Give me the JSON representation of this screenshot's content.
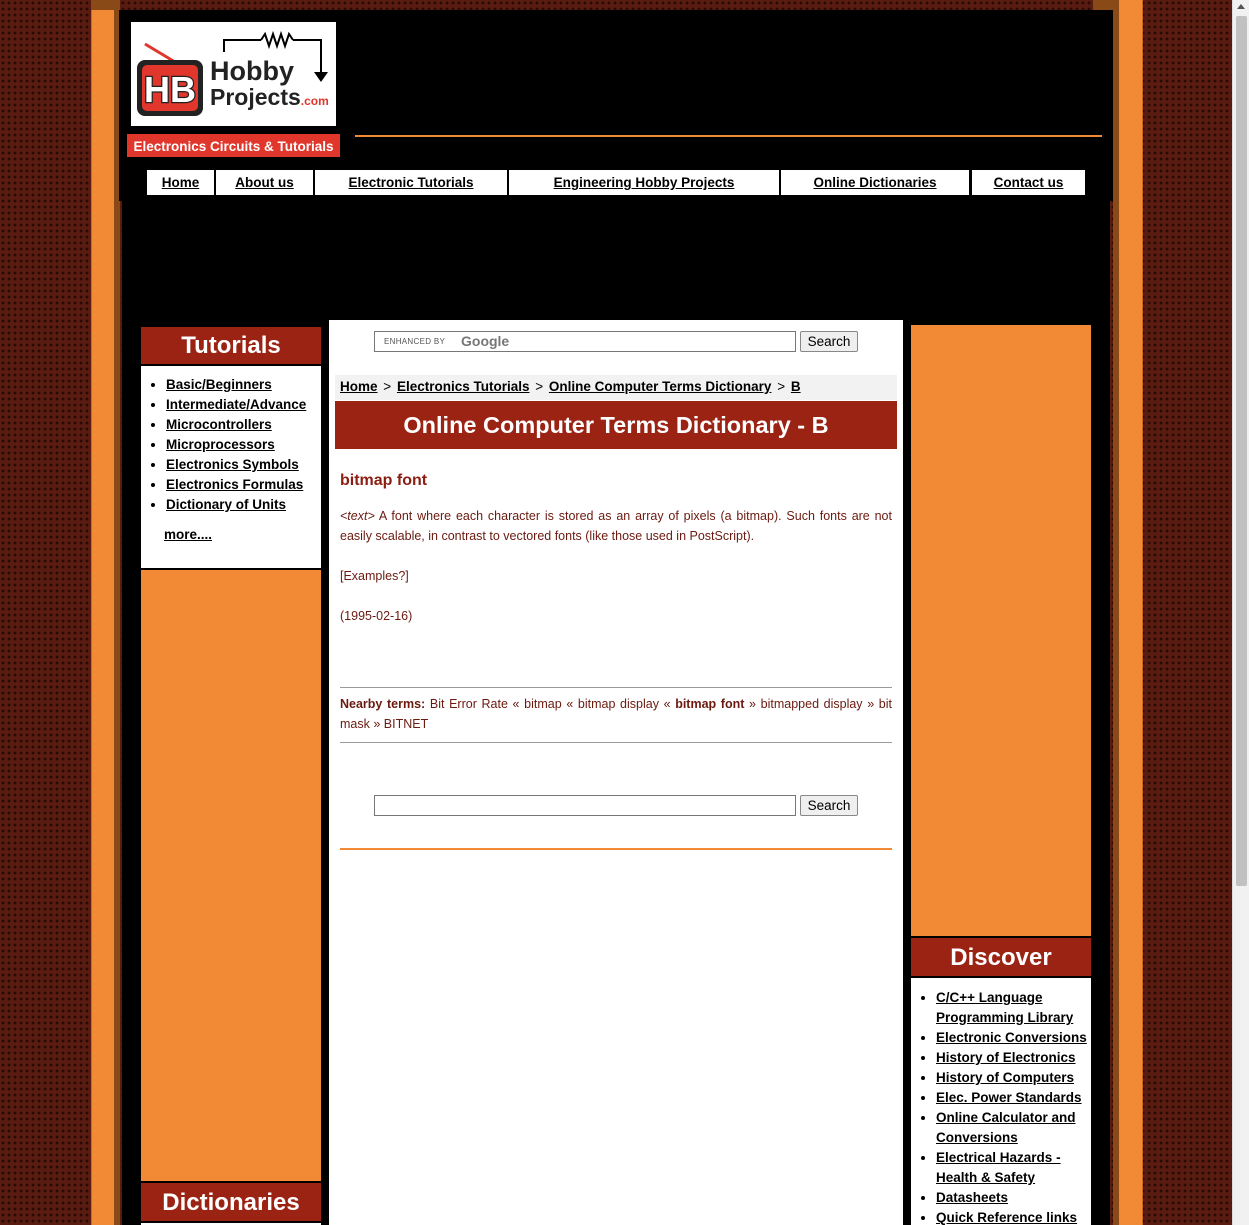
{
  "header": {
    "logo_text_line1": "Hobby",
    "logo_text_line2": "Projects",
    "logo_text_suffix": ".com",
    "logo_monogram": "HB",
    "tagline": "Electronics Circuits & Tutorials"
  },
  "nav": {
    "items": [
      "Home",
      "About us",
      "Electronic Tutorials",
      "Engineering Hobby Projects",
      "Online Dictionaries",
      "Contact us"
    ]
  },
  "left_sidebar": {
    "tutorials_heading": "Tutorials",
    "tutorials_items": [
      "Basic/Beginners",
      "Intermediate/Advance",
      "Microcontrollers",
      "Microprocessors",
      "Electronics Symbols",
      "Electronics Formulas",
      "Dictionary of Units"
    ],
    "more_link": "more....",
    "dictionaries_heading": "Dictionaries"
  },
  "right_sidebar": {
    "discover_heading": "Discover",
    "discover_items": [
      "C/C++ Language Programming Library",
      "Electronic Conversions",
      "History of Electronics",
      "History of Computers",
      "Elec. Power Standards",
      "Online Calculator and Conversions",
      "Electrical Hazards - Health & Safety",
      "Datasheets",
      "Quick Reference links"
    ]
  },
  "search": {
    "brand_prefix": "ENHANCED BY",
    "brand_name": "Google",
    "button_label": "Search",
    "bottom_button_label": "Search"
  },
  "breadcrumb": {
    "items": [
      "Home",
      "Electronics Tutorials",
      "Online Computer Terms Dictionary",
      "B"
    ],
    "separator": ">"
  },
  "main": {
    "page_title": "Online Computer Terms Dictionary - B",
    "term": "bitmap font",
    "category_tag": "<text>",
    "definition": "A font where each character is stored as an array of pixels (a bitmap). Such fonts are not easily scalable, in contrast to vectored fonts (like those used in PostScript).",
    "examples_note": "[Examples?]",
    "date": "(1995-02-16)",
    "nearby_label": "Nearby terms:",
    "nearby_before": [
      "Bit Error Rate",
      "bitmap",
      "bitmap display"
    ],
    "nearby_current": "bitmap font",
    "nearby_after": [
      "bitmapped display",
      "bit mask",
      "BITNET"
    ],
    "nearby_back_sep": "«",
    "nearby_fwd_sep": "»"
  },
  "colors": {
    "accent_orange": "#f28a35",
    "heading_red": "#9b2314",
    "tagline_red": "#e0362c",
    "text_brown": "#6b1a10"
  }
}
